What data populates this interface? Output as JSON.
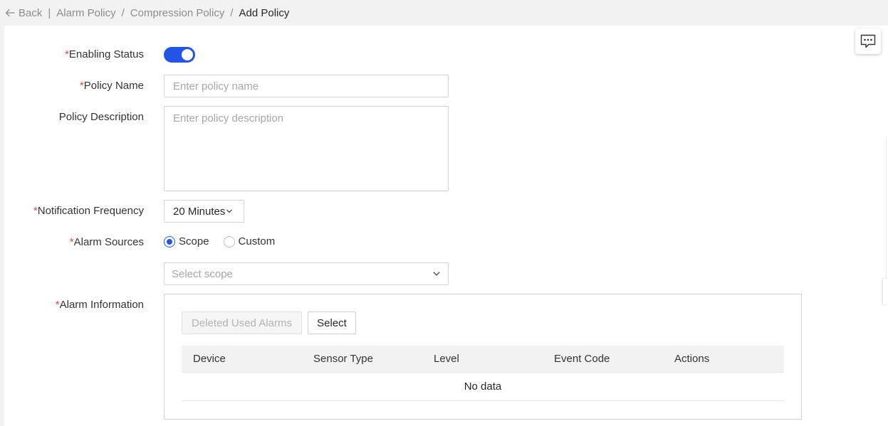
{
  "breadcrumb": {
    "back_label": "Back",
    "items": [
      "Alarm Policy",
      "Compression Policy"
    ],
    "current": "Add Policy"
  },
  "form": {
    "enabling_status": {
      "label": "Enabling Status",
      "enabled": true
    },
    "policy_name": {
      "label": "Policy Name",
      "placeholder": "Enter policy name",
      "value": ""
    },
    "policy_description": {
      "label": "Policy Description",
      "placeholder": "Enter policy description",
      "value": ""
    },
    "notification_frequency": {
      "label": "Notification Frequency",
      "value": "20 Minutes"
    },
    "alarm_sources": {
      "label": "Alarm Sources",
      "options": [
        "Scope",
        "Custom"
      ],
      "selected": "Scope",
      "scope_placeholder": "Select scope"
    },
    "alarm_information": {
      "label": "Alarm Information",
      "delete_button": "Deleted Used Alarms",
      "select_button": "Select",
      "columns": [
        "Device",
        "Sensor Type",
        "Level",
        "Event Code",
        "Actions"
      ],
      "rows": [],
      "empty_text": "No data"
    }
  },
  "required_mark": "*",
  "colors": {
    "accent": "#2354e6",
    "required": "#e5463b"
  }
}
